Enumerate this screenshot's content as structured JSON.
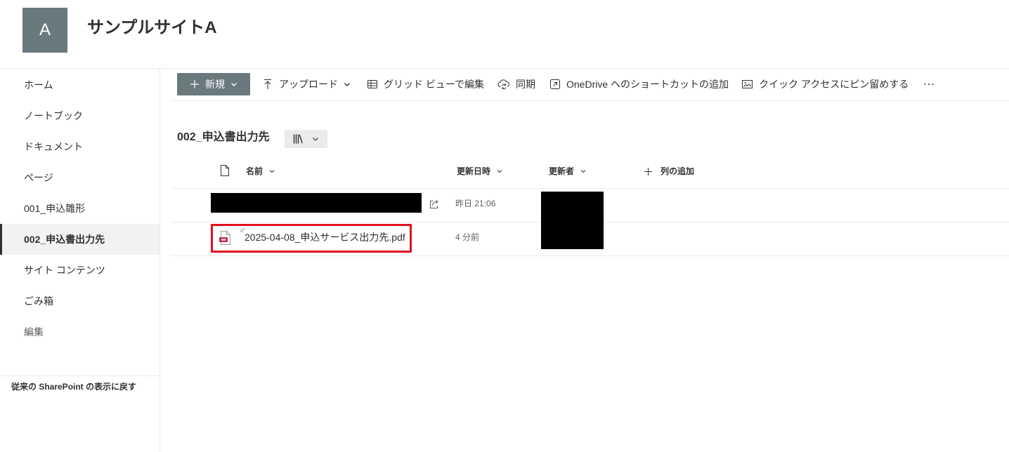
{
  "site": {
    "logo_letter": "A",
    "title": "サンプルサイトA"
  },
  "nav": {
    "items": [
      {
        "label": "ホーム"
      },
      {
        "label": "ノートブック"
      },
      {
        "label": "ドキュメント"
      },
      {
        "label": "ページ"
      },
      {
        "label": "001_申込雛形"
      },
      {
        "label": "002_申込書出力先",
        "selected": true
      },
      {
        "label": "サイト コンテンツ"
      },
      {
        "label": "ごみ箱"
      },
      {
        "label": "編集"
      }
    ],
    "classic_link": "従来の SharePoint の表示に戻す"
  },
  "command_bar": {
    "new_label": "新規",
    "upload_label": "アップロード",
    "grid_edit_label": "グリッド ビューで編集",
    "sync_label": "同期",
    "onedrive_shortcut_label": "OneDrive へのショートカットの追加",
    "pin_quick_access_label": "クイック アクセスにピン留めする"
  },
  "library": {
    "title": "002_申込書出力先"
  },
  "columns": {
    "name": "名前",
    "modified": "更新日時",
    "modified_by": "更新者",
    "add_column": "列の追加"
  },
  "files": [
    {
      "name_redacted": true,
      "modified": "昨日 21:06",
      "modified_by_redacted": true
    },
    {
      "name": "2025-04-08_申込サービス出力先.pdf",
      "modified": "4 分前",
      "modified_by_redacted": true,
      "icon": "pdf-file-icon"
    }
  ],
  "icons": {
    "new": [
      "plus-icon",
      "chevron-down-icon"
    ],
    "upload": [
      "upload-icon",
      "chevron-down-icon"
    ],
    "grid_edit": "grid-icon",
    "sync": "sync-icon",
    "onedrive_shortcut": "shortcut-icon",
    "pin_quick_access": "pin-icon",
    "more": "more-icon",
    "view_switcher": [
      "library-view-icon",
      "chevron-down-icon"
    ],
    "file_type_column": "document-icon",
    "share": "share-icon",
    "new_item": "new-item-sparkle-icon",
    "add_column": "plus-icon"
  },
  "colors": {
    "accent": "#69797e",
    "text": "#323130",
    "secondary_text": "#605e5c",
    "border": "#edebe9",
    "selected_bg": "#f3f2f1",
    "button_bg": "#edebe9",
    "highlight": "#e3101e",
    "pdf_red": "#c4314b",
    "redaction": "#000000"
  }
}
